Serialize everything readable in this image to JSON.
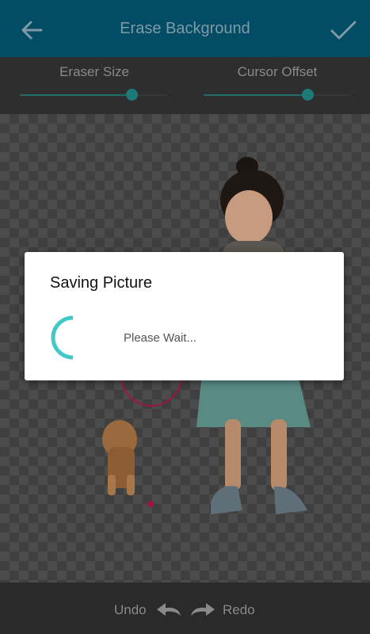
{
  "header": {
    "title": "Erase Background",
    "back_icon": "arrow-left-icon",
    "confirm_icon": "checkmark-icon"
  },
  "controls": {
    "eraser_size": {
      "label": "Eraser Size",
      "value_fraction": 0.76
    },
    "cursor_offset": {
      "label": "Cursor Offset",
      "value_fraction": 0.71
    }
  },
  "dialog": {
    "title": "Saving Picture",
    "message": "Please Wait..."
  },
  "footer": {
    "undo_label": "Undo",
    "redo_label": "Redo"
  },
  "colors": {
    "header_bg": "#024c66",
    "accent": "#40c9c8",
    "slider_fill": "#1e7a78"
  }
}
